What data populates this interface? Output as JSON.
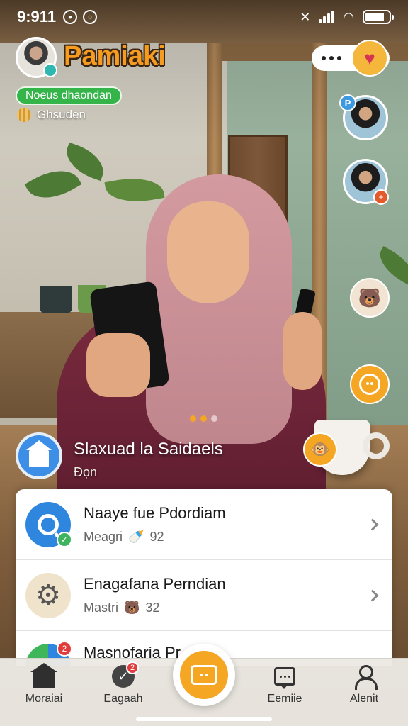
{
  "status_bar": {
    "time": "9:911"
  },
  "profile": {
    "app_name": "Pamiaki",
    "status_label": "Noeus dhaondan",
    "sub_label": "Ghsuden"
  },
  "caption": {
    "title": "Slaxuad la Saidaels",
    "subtitle": "Đọn"
  },
  "list": {
    "items": [
      {
        "title": "Naaye fue Pdordiam",
        "meta_label": "Meagri",
        "meta_value": "92",
        "icon": "search-icon"
      },
      {
        "title": "Enagafana Perndian",
        "meta_label": "Mastri",
        "meta_value": "32",
        "icon": "gear-icon"
      },
      {
        "title": "Masnofaria Pr...",
        "icon": "chart-icon",
        "badge": "2"
      }
    ]
  },
  "bottom_nav": {
    "items": [
      {
        "label": "Moraiai",
        "icon": "home-icon"
      },
      {
        "label": "Eagaah",
        "icon": "check-circle-icon",
        "badge": "2"
      },
      {
        "label": "Eemiie",
        "icon": "message-icon"
      },
      {
        "label": "Alenit",
        "icon": "person-icon"
      }
    ]
  },
  "colors": {
    "accent": "#f5a623",
    "status_green": "#35b44a",
    "primary_blue": "#2f86df"
  }
}
